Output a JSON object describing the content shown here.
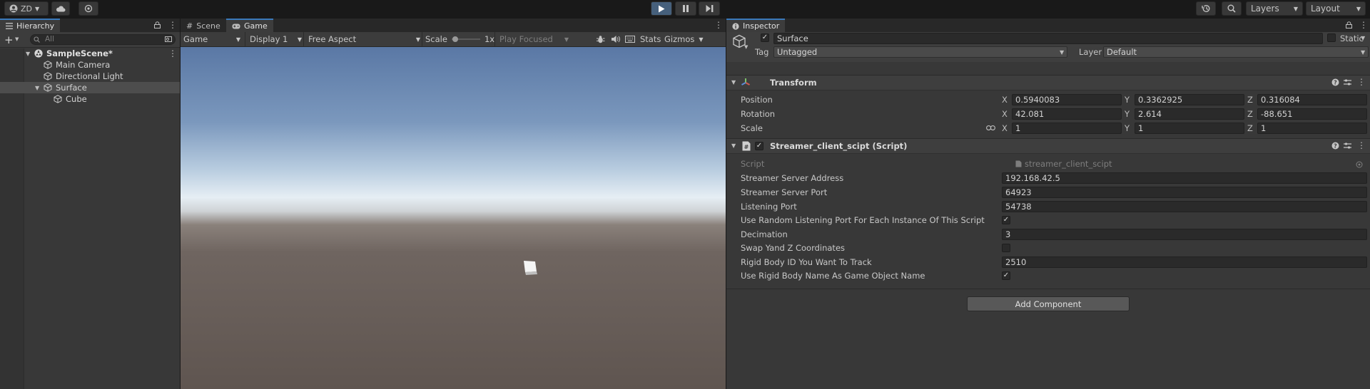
{
  "toolbar": {
    "account_label": "ZD",
    "layers_label": "Layers",
    "layout_label": "Layout"
  },
  "hierarchy": {
    "tab_label": "Hierarchy",
    "search_placeholder": "All",
    "items": [
      {
        "label": "SampleScene*"
      },
      {
        "label": "Main Camera"
      },
      {
        "label": "Directional Light"
      },
      {
        "label": "Surface"
      },
      {
        "label": "Cube"
      }
    ]
  },
  "gameview": {
    "tabs": [
      {
        "label": "Scene"
      },
      {
        "label": "Game"
      }
    ],
    "game_dropdown": "Game",
    "display_dropdown": "Display 1",
    "aspect_dropdown": "Free Aspect",
    "scale_label": "Scale",
    "scale_value": "1x",
    "play_focused": "Play Focused",
    "stats_label": "Stats",
    "gizmos_label": "Gizmos"
  },
  "inspector": {
    "tab_label": "Inspector",
    "object_name": "Surface",
    "static_label": "Static",
    "tag_label": "Tag",
    "tag_value": "Untagged",
    "layer_label": "Layer",
    "layer_value": "Default",
    "transform": {
      "title": "Transform",
      "position_label": "Position",
      "rotation_label": "Rotation",
      "scale_label": "Scale",
      "axis_x": "X",
      "axis_y": "Y",
      "axis_z": "Z",
      "position": {
        "x": "0.5940083",
        "y": "0.3362925",
        "z": "0.316084"
      },
      "rotation": {
        "x": "42.081",
        "y": "2.614",
        "z": "-88.651"
      },
      "scale": {
        "x": "1",
        "y": "1",
        "z": "1"
      }
    },
    "script": {
      "title": "Streamer_client_scipt (Script)",
      "script_label": "Script",
      "script_value": "streamer_client_scipt",
      "fields": [
        {
          "label": "Streamer Server Address",
          "value": "192.168.42.5"
        },
        {
          "label": "Streamer Server Port",
          "value": "64923"
        },
        {
          "label": "Listening Port",
          "value": "54738"
        },
        {
          "label": "Use Random Listening Port For Each Instance Of This Script",
          "checked": "✓"
        },
        {
          "label": "Decimation",
          "value": "3"
        },
        {
          "label": "Swap Yand Z Coordinates",
          "checked": ""
        },
        {
          "label": "Rigid Body ID You Want To Track",
          "value": "2510"
        },
        {
          "label": "Use Rigid Body Name As Game Object Name",
          "checked": "✓"
        }
      ]
    },
    "add_component_label": "Add Component"
  }
}
